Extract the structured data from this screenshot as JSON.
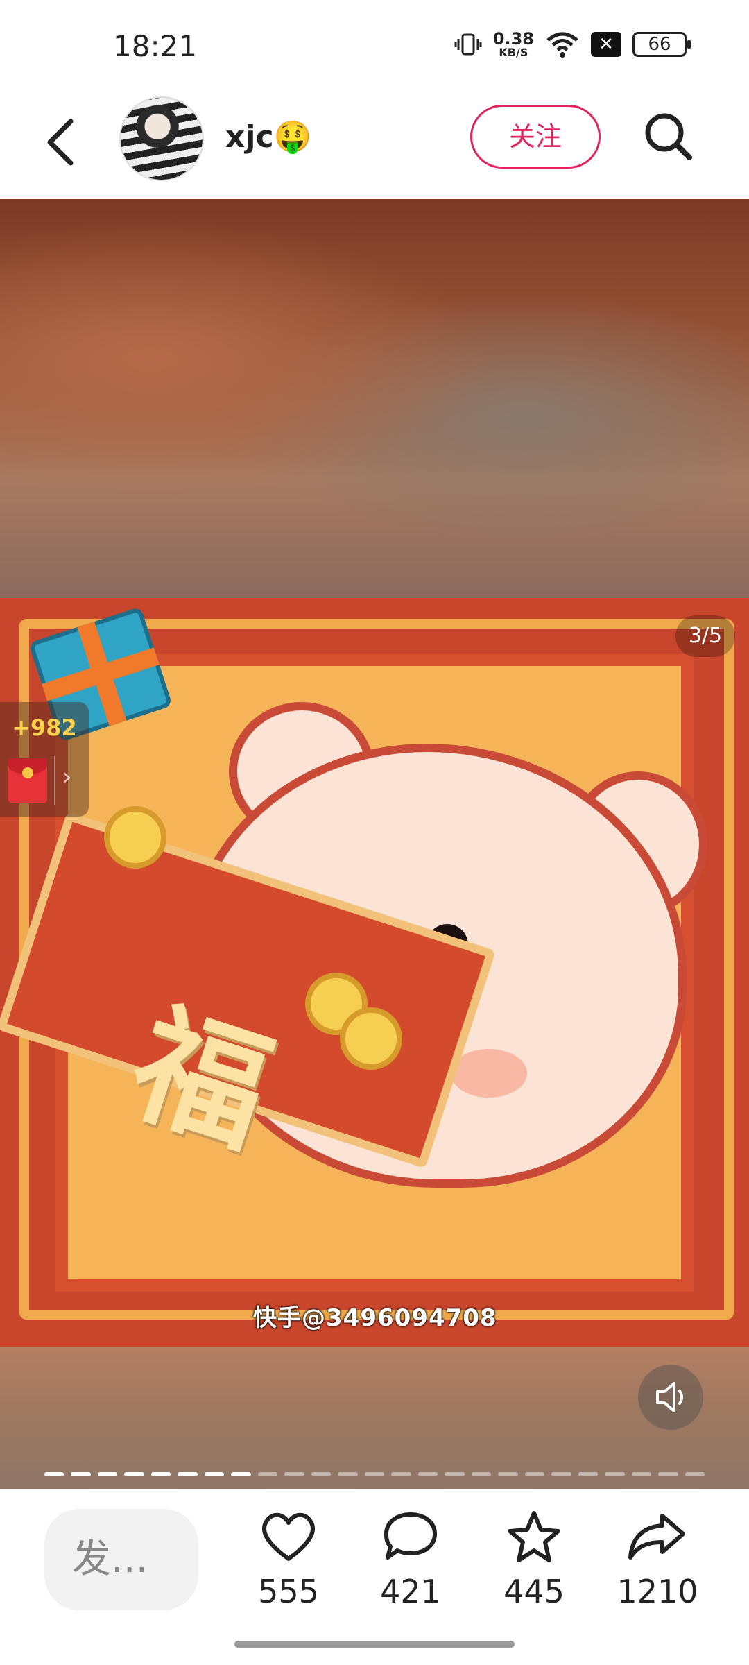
{
  "status_bar": {
    "time": "18:21",
    "net_speed_value": "0.38",
    "net_speed_unit": "KB/S",
    "battery": "66",
    "icons": [
      "vibrate-icon",
      "wifi-icon",
      "no-sim-icon",
      "battery-icon"
    ]
  },
  "header": {
    "username": "xjc🤑",
    "follow_label": "关注",
    "icons": [
      "back-arrow-icon",
      "search-icon"
    ]
  },
  "media": {
    "page_counter": "3/5",
    "watermark": "快手@3496094708",
    "scroll_character": "福",
    "reward": {
      "amount": "+982",
      "arrow": "›"
    },
    "dots": {
      "total": 25,
      "active": 8
    }
  },
  "bottom_bar": {
    "comment_placeholder": "发...",
    "actions": [
      {
        "name": "like",
        "icon": "heart-icon",
        "count": "555"
      },
      {
        "name": "comment",
        "icon": "comment-icon",
        "count": "421"
      },
      {
        "name": "favorite",
        "icon": "star-icon",
        "count": "445"
      },
      {
        "name": "share",
        "icon": "share-icon",
        "count": "1210"
      }
    ]
  }
}
